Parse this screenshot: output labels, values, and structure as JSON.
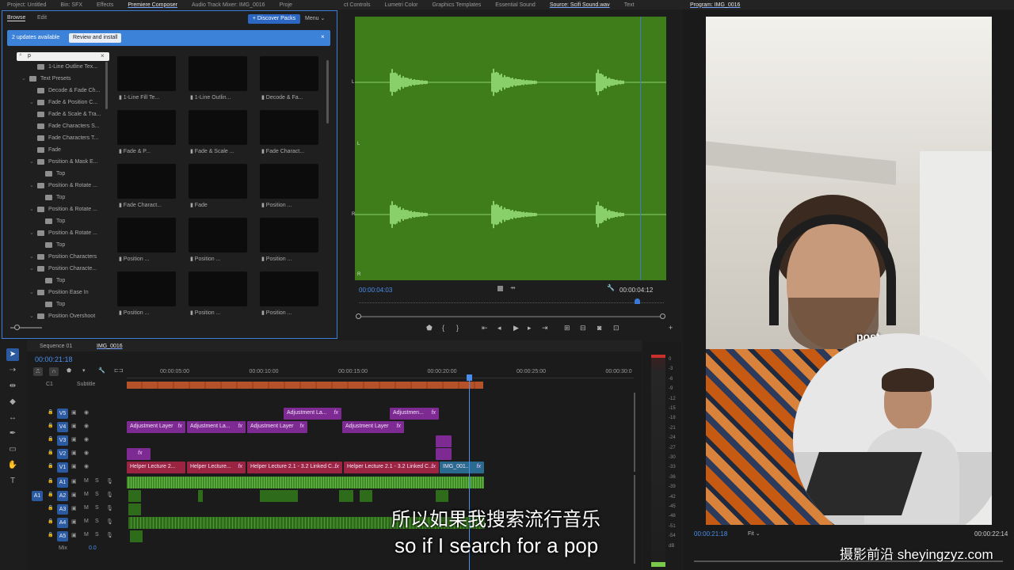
{
  "top_tabs_left": [
    "Project: Untitled",
    "Bin: SFX",
    "Effects",
    "Premiere Composer",
    "Audio Track Mixer: IMG_0016",
    "Proje"
  ],
  "top_tabs_mid": [
    "ct Controls",
    "Lumetri Color",
    "Graphics Templates",
    "Essential Sound",
    "Source: Scifi Sound.wav",
    "Text"
  ],
  "program_title": "Program: IMG_0016",
  "composer": {
    "subtabs": [
      "Browse",
      "Edit"
    ],
    "discover_label": "+ Discover Packs",
    "menu_label": "Menu",
    "updates_text": "2 updates available",
    "review_label": "Review and install",
    "search_value": "p",
    "tree": [
      {
        "label": "1-Line Outline Tex...",
        "kind": "item",
        "indent": 2
      },
      {
        "label": "Text Presets",
        "kind": "folder",
        "indent": 1
      },
      {
        "label": "Decode & Fade Ch...",
        "kind": "item",
        "indent": 2
      },
      {
        "label": "Fade & Position C...",
        "kind": "folder",
        "indent": 2
      },
      {
        "label": "Fade & Scale & Tra...",
        "kind": "item",
        "indent": 2
      },
      {
        "label": "Fade Characters S...",
        "kind": "item",
        "indent": 2
      },
      {
        "label": "Fade Characters T...",
        "kind": "item",
        "indent": 2
      },
      {
        "label": "Fade",
        "kind": "item",
        "indent": 2
      },
      {
        "label": "Position & Mask E...",
        "kind": "folder",
        "indent": 2
      },
      {
        "label": "Top",
        "kind": "item",
        "indent": 3
      },
      {
        "label": "Position & Rotate ...",
        "kind": "folder",
        "indent": 2
      },
      {
        "label": "Top",
        "kind": "item",
        "indent": 3
      },
      {
        "label": "Position & Rotate ...",
        "kind": "folder",
        "indent": 2
      },
      {
        "label": "Top",
        "kind": "item",
        "indent": 3
      },
      {
        "label": "Position & Rotate ...",
        "kind": "folder",
        "indent": 2
      },
      {
        "label": "Top",
        "kind": "item",
        "indent": 3
      },
      {
        "label": "Position Characters",
        "kind": "folder",
        "indent": 2
      },
      {
        "label": "Position Characte...",
        "kind": "folder",
        "indent": 2
      },
      {
        "label": "Top",
        "kind": "item",
        "indent": 3
      },
      {
        "label": "Position Ease In",
        "kind": "folder",
        "indent": 2
      },
      {
        "label": "Top",
        "kind": "item",
        "indent": 3
      },
      {
        "label": "Position Overshoot",
        "kind": "folder",
        "indent": 2
      }
    ],
    "grid": [
      [
        "1-Line Fill Te...",
        "1-Line Outlin...",
        "Decode & Fa..."
      ],
      [
        "Fade & P...",
        "Fade & Scale ...",
        "Fade Charact..."
      ],
      [
        "Fade Charact...",
        "Fade",
        "Position ..."
      ],
      [
        "Position ...",
        "Position ...",
        "Position ..."
      ],
      [
        "Position ...",
        "Position ...",
        "Position ..."
      ]
    ]
  },
  "source": {
    "channel_labels": [
      "L",
      "L",
      "R",
      "R"
    ],
    "timecode_in": "00:00:04:03",
    "timecode_dur": "00:00:04:12"
  },
  "timeline": {
    "tabs": [
      "Sequence 01",
      "IMG_0016"
    ],
    "timecode": "00:00:21:18",
    "ruler": [
      "00:00:05:00",
      "00:00:10:00",
      "00:00:15:00",
      "00:00:20:00",
      "00:00:25:00",
      "00:00:30:0"
    ],
    "subtitle_track": "C1",
    "subtitle_label": "Subtitle",
    "video_tracks": [
      "V5",
      "V4",
      "V3",
      "V2",
      "V1"
    ],
    "audio_tracks": [
      "A1",
      "A2",
      "A3",
      "A4",
      "A5"
    ],
    "source_patch": "A1",
    "mix_label": "Mix",
    "mix_value": "0.0",
    "clips": {
      "v5a": "Adjustment La...",
      "v5b": "Adjustmen...",
      "v4a": "Adjustment Layer",
      "v4b": "Adjustment La...",
      "v4c": "Adjustment Layer",
      "v4d": "Adjustment Layer",
      "v1a": "Helper Lecture 2...",
      "v1b": "Helper Lecture...",
      "v1c": "Helper Lecture 2.1 - 3.2 Linked C...",
      "v1d": "Helper Lecture 2.1 - 3.2 Linked C...",
      "v1e": "IMG_001...",
      "fx": "fx"
    },
    "meter_labels": [
      "0",
      "-3",
      "-6",
      "-9",
      "-12",
      "-15",
      "-18",
      "-21",
      "-24",
      "-27",
      "-30",
      "-33",
      "-36",
      "-39",
      "-42",
      "-45",
      "-48",
      "-51",
      "-54",
      "dB"
    ]
  },
  "program": {
    "timecode": "00:00:21:18",
    "fit": "Fit",
    "duration": "00:00:22:14",
    "overlay_word": "post"
  },
  "subtitle_cn": "所以如果我搜索流行音乐",
  "subtitle_en": "so if I search for a pop",
  "watermark": "摄影前沿 sheyingzyz.com",
  "colors": {
    "accent": "#3d7fd8",
    "source_bg": "#3e7d1a",
    "waveform": "#8ad06a",
    "clip_purple": "#7d2a93",
    "clip_red": "#9c2443"
  }
}
